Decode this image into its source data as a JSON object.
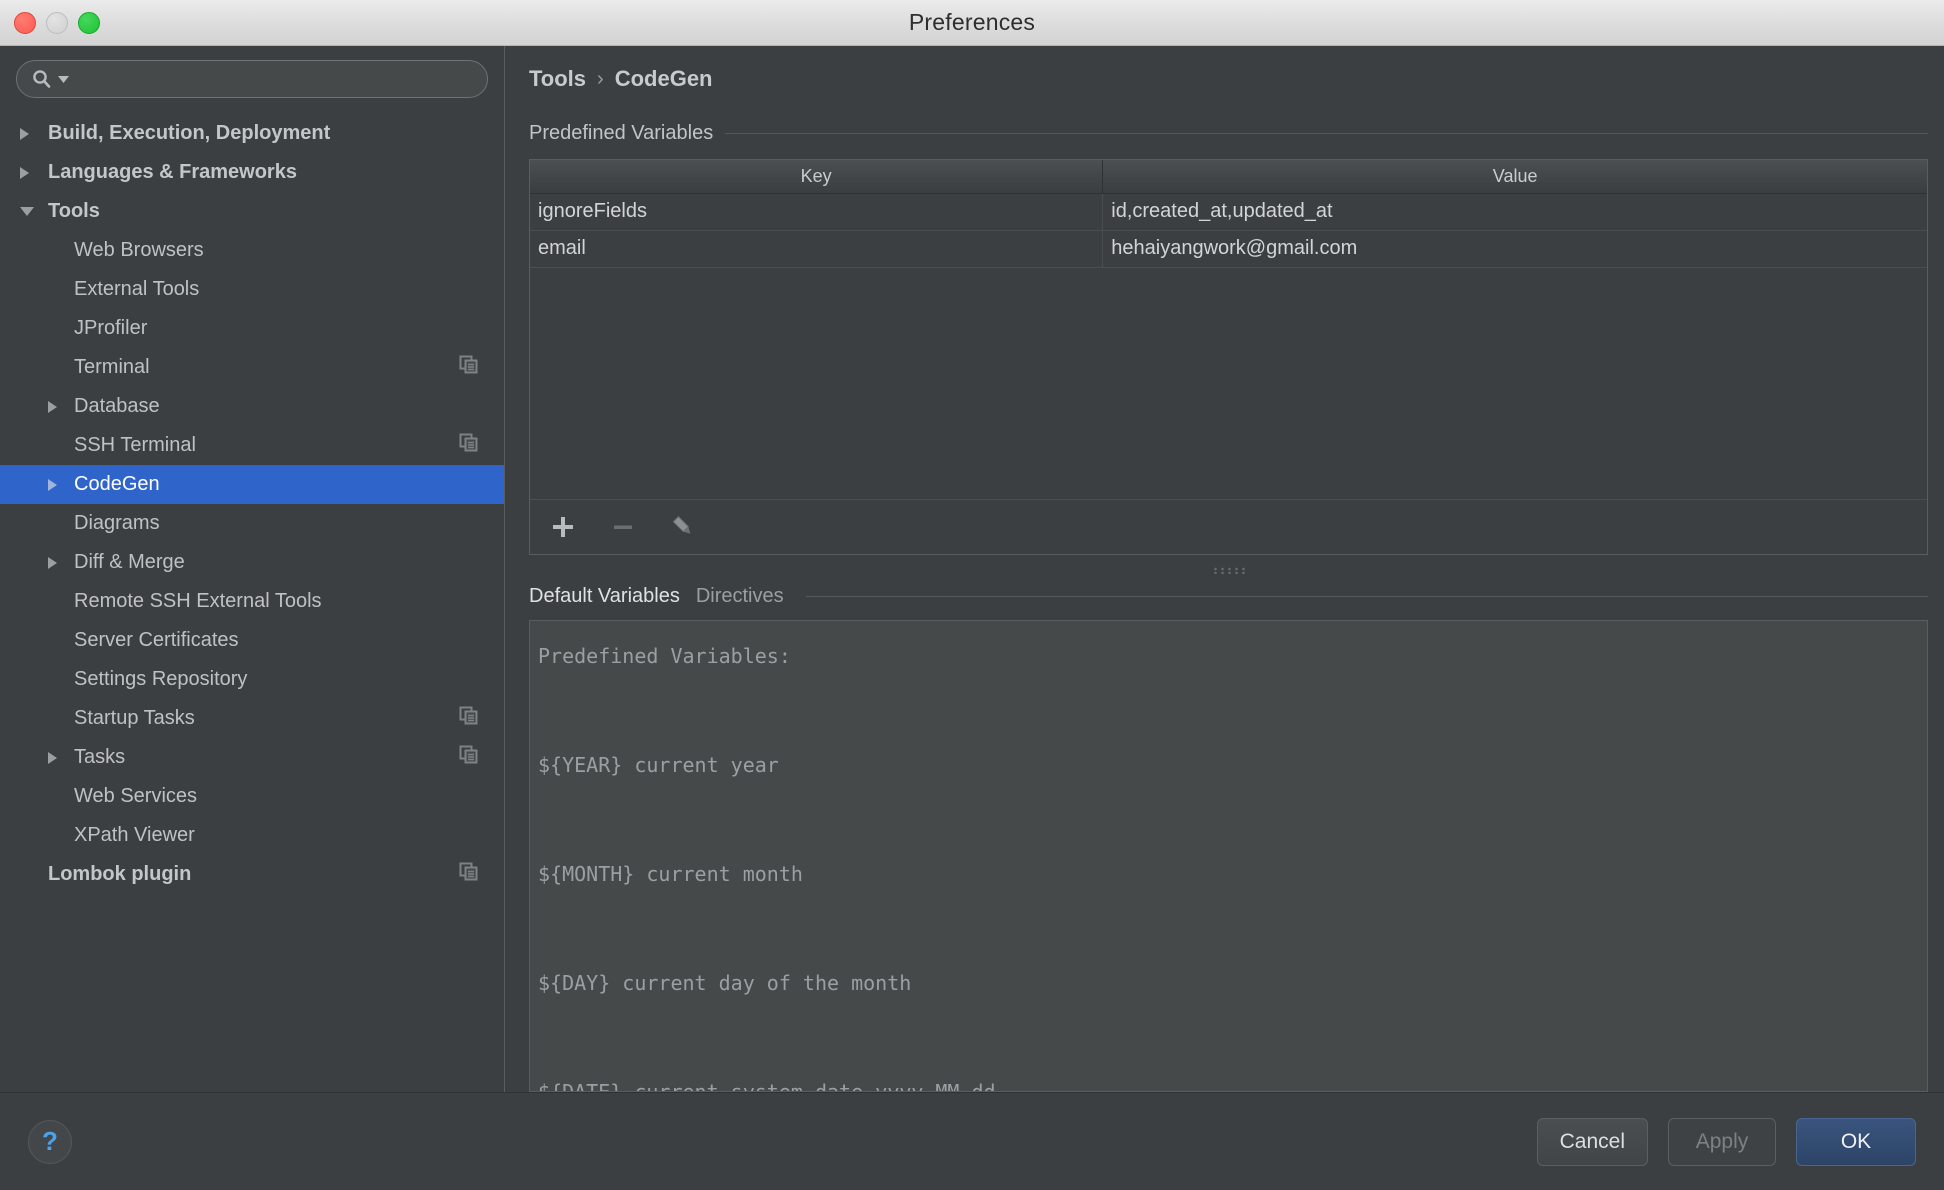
{
  "window": {
    "title": "Preferences",
    "traffic_lights": [
      "close",
      "minimize",
      "zoom"
    ]
  },
  "search": {
    "placeholder": "",
    "value": "",
    "icon": "search-icon"
  },
  "sidebar": {
    "items": [
      {
        "label": "Build, Execution, Deployment",
        "depth": 0,
        "arrow": "right",
        "bold": true,
        "selected": false,
        "copy_icon": false
      },
      {
        "label": "Languages & Frameworks",
        "depth": 0,
        "arrow": "right",
        "bold": true,
        "selected": false,
        "copy_icon": false
      },
      {
        "label": "Tools",
        "depth": 0,
        "arrow": "down",
        "bold": true,
        "selected": false,
        "copy_icon": false
      },
      {
        "label": "Web Browsers",
        "depth": 1,
        "arrow": "none",
        "bold": false,
        "selected": false,
        "copy_icon": false
      },
      {
        "label": "External Tools",
        "depth": 1,
        "arrow": "none",
        "bold": false,
        "selected": false,
        "copy_icon": false
      },
      {
        "label": "JProfiler",
        "depth": 1,
        "arrow": "none",
        "bold": false,
        "selected": false,
        "copy_icon": false
      },
      {
        "label": "Terminal",
        "depth": 1,
        "arrow": "none",
        "bold": false,
        "selected": false,
        "copy_icon": true
      },
      {
        "label": "Database",
        "depth": 1,
        "arrow": "right",
        "bold": false,
        "selected": false,
        "copy_icon": false
      },
      {
        "label": "SSH Terminal",
        "depth": 1,
        "arrow": "none",
        "bold": false,
        "selected": false,
        "copy_icon": true
      },
      {
        "label": "CodeGen",
        "depth": 1,
        "arrow": "right",
        "bold": false,
        "selected": true,
        "copy_icon": false
      },
      {
        "label": "Diagrams",
        "depth": 1,
        "arrow": "none",
        "bold": false,
        "selected": false,
        "copy_icon": false
      },
      {
        "label": "Diff & Merge",
        "depth": 1,
        "arrow": "right",
        "bold": false,
        "selected": false,
        "copy_icon": false
      },
      {
        "label": "Remote SSH External Tools",
        "depth": 1,
        "arrow": "none",
        "bold": false,
        "selected": false,
        "copy_icon": false
      },
      {
        "label": "Server Certificates",
        "depth": 1,
        "arrow": "none",
        "bold": false,
        "selected": false,
        "copy_icon": false
      },
      {
        "label": "Settings Repository",
        "depth": 1,
        "arrow": "none",
        "bold": false,
        "selected": false,
        "copy_icon": false
      },
      {
        "label": "Startup Tasks",
        "depth": 1,
        "arrow": "none",
        "bold": false,
        "selected": false,
        "copy_icon": true
      },
      {
        "label": "Tasks",
        "depth": 1,
        "arrow": "right",
        "bold": false,
        "selected": false,
        "copy_icon": true
      },
      {
        "label": "Web Services",
        "depth": 1,
        "arrow": "none",
        "bold": false,
        "selected": false,
        "copy_icon": false
      },
      {
        "label": "XPath Viewer",
        "depth": 1,
        "arrow": "none",
        "bold": false,
        "selected": false,
        "copy_icon": false
      },
      {
        "label": "Lombok plugin",
        "depth": 0,
        "arrow": "none",
        "bold": true,
        "selected": false,
        "copy_icon": true
      }
    ]
  },
  "breadcrumb": {
    "root": "Tools",
    "separator": "›",
    "current": "CodeGen"
  },
  "predefined_variables": {
    "section_label": "Predefined Variables",
    "columns": [
      "Key",
      "Value"
    ],
    "rows": [
      {
        "key": "ignoreFields",
        "value": "id,created_at,updated_at"
      },
      {
        "key": "email",
        "value": "hehaiyangwork@gmail.com"
      }
    ],
    "toolbar": [
      {
        "name": "add-variable-button",
        "icon": "plus-icon",
        "enabled": true
      },
      {
        "name": "remove-variable-button",
        "icon": "minus-icon",
        "enabled": false
      },
      {
        "name": "edit-variable-button",
        "icon": "pencil-icon",
        "enabled": true
      }
    ]
  },
  "lower_panel": {
    "tabs": [
      {
        "label": "Default Variables",
        "active": true
      },
      {
        "label": "Directives",
        "active": false
      }
    ],
    "editor_text": "Predefined Variables:\n\n${YEAR} current year\n\n${MONTH} current month\n\n${DAY} current day of the month\n\n${DATE} current system date yyyy-MM-dd"
  },
  "footer": {
    "help_label": "?",
    "cancel_label": "Cancel",
    "apply_label": "Apply",
    "apply_enabled": false,
    "ok_label": "OK"
  },
  "colors": {
    "window_bg": "#3c3f41",
    "selection_blue": "#2f65ca",
    "primary_button": "#35507a",
    "help_blue": "#4da3e8",
    "text": "#bfc2c4"
  }
}
